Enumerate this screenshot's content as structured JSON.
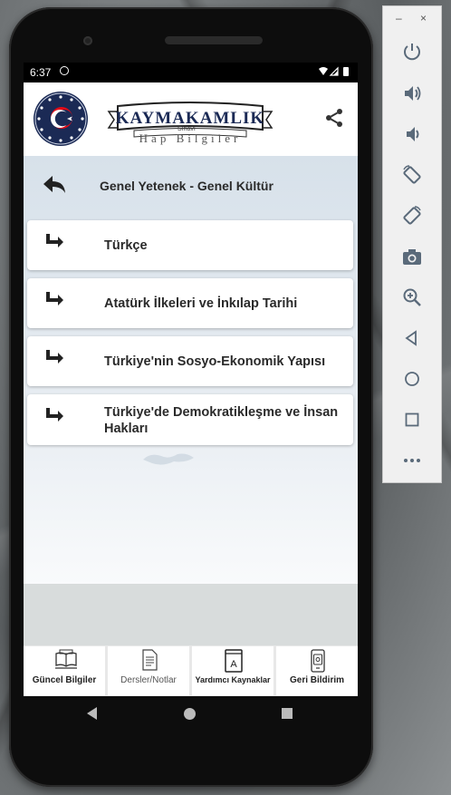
{
  "status": {
    "time": "6:37"
  },
  "app": {
    "logo_title": "KAYMAKAMLIK",
    "logo_small": "Sınavı",
    "logo_sub": "Hap Bilgiler"
  },
  "page": {
    "title": "Genel Yetenek - Genel Kültür"
  },
  "topics": [
    {
      "label": "Türkçe"
    },
    {
      "label": "Atatürk İlkeleri ve İnkılap Tarihi"
    },
    {
      "label": "Türkiye'nin Sosyo-Ekonomik Yapısı"
    },
    {
      "label": "Türkiye'de Demokratikleşme ve İnsan Hakları"
    }
  ],
  "bottom_nav": [
    {
      "label": "Güncel Bilgiler",
      "icon": "book-open-icon"
    },
    {
      "label": "Dersler/Notlar",
      "icon": "document-icon"
    },
    {
      "label": "Yardımcı Kaynaklar",
      "icon": "book-a-icon"
    },
    {
      "label": "Geri Bildirim",
      "icon": "feedback-phone-icon"
    }
  ],
  "emulator_panel": {
    "buttons": [
      "power-icon",
      "volume-up-icon",
      "volume-down-icon",
      "rotate-left-icon",
      "rotate-right-icon",
      "camera-icon",
      "zoom-icon",
      "back-icon",
      "home-icon",
      "overview-icon",
      "more-icon"
    ]
  },
  "colors": {
    "emblem": "#1b2a55",
    "flag_red": "#e30a17",
    "content_bg": "#d7e1ea"
  }
}
